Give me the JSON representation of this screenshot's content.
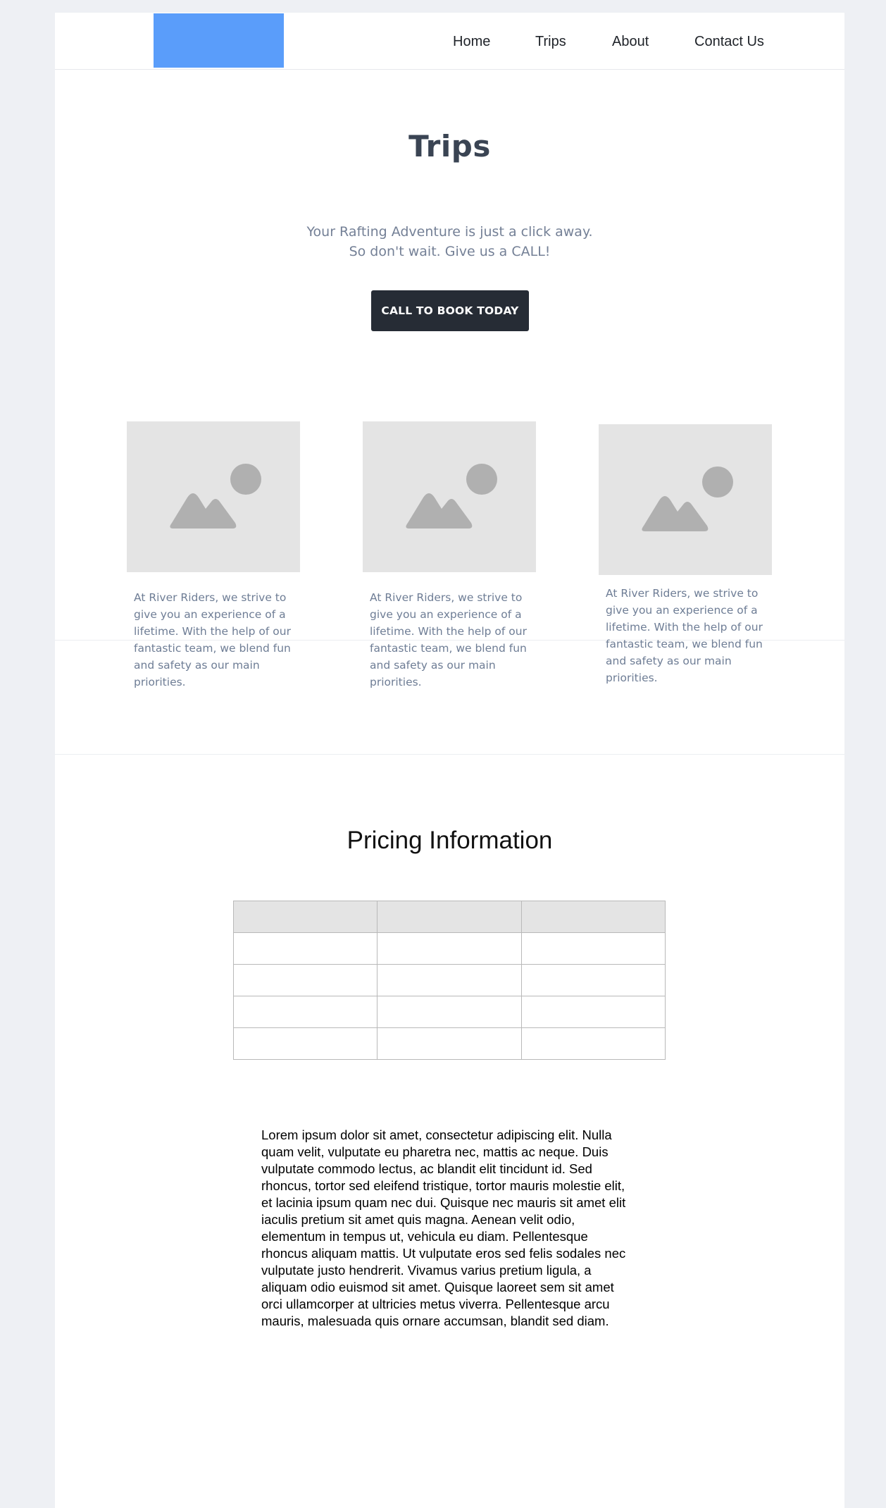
{
  "nav": {
    "items": [
      "Home",
      "Trips",
      "About",
      "Contact Us"
    ]
  },
  "hero": {
    "title": "Trips",
    "subtitle_line1": "Your Rafting Adventure is just a click away.",
    "subtitle_line2": "So don't wait. Give us a CALL!",
    "cta_label": "CALL TO BOOK TODAY"
  },
  "cards": [
    {
      "text": "At River Riders, we strive to give you an experience of a lifetime. With the help of our fantastic team, we blend fun and safety as our main priorities."
    },
    {
      "text": "At River Riders, we strive to give you an experience of a lifetime. With the help of our fantastic team, we blend fun and safety as our main priorities."
    },
    {
      "text": "At River Riders, we strive to give you an experience of a lifetime. With the help of our fantastic team, we blend fun and safety as our main priorities."
    }
  ],
  "pricing": {
    "title": "Pricing Information",
    "header": [
      "",
      "",
      ""
    ],
    "rows": [
      [
        "",
        "",
        ""
      ],
      [
        "",
        "",
        ""
      ],
      [
        "",
        "",
        ""
      ],
      [
        "",
        "",
        ""
      ]
    ],
    "body": "Lorem ipsum dolor sit amet, consectetur adipiscing elit. Nulla quam velit, vulputate eu pharetra nec, mattis ac neque. Duis vulputate commodo lectus, ac blandit elit tincidunt id. Sed rhoncus, tortor sed eleifend tristique, tortor mauris molestie elit, et lacinia ipsum quam nec dui. Quisque nec mauris sit amet elit iaculis pretium sit amet quis magna. Aenean velit odio, elementum in tempus ut, vehicula eu diam. Pellentesque rhoncus aliquam mattis. Ut vulputate eros sed felis sodales nec vulputate justo hendrerit. Vivamus varius pretium ligula, a aliquam odio euismod sit amet. Quisque laoreet sem sit amet orci ullamcorper at ultricies metus viverra. Pellentesque arcu mauris, malesuada quis ornare accumsan, blandit sed diam."
  },
  "colors": {
    "page_bg": "#eef0f4",
    "logo": "#5a9dfa",
    "heading": "#3a4453",
    "muted_text": "#748096",
    "button_bg": "#262c35",
    "placeholder_bg": "#e4e4e4",
    "placeholder_icon": "#b0b0b0"
  },
  "icons": {
    "card_image": "image-placeholder-icon"
  }
}
